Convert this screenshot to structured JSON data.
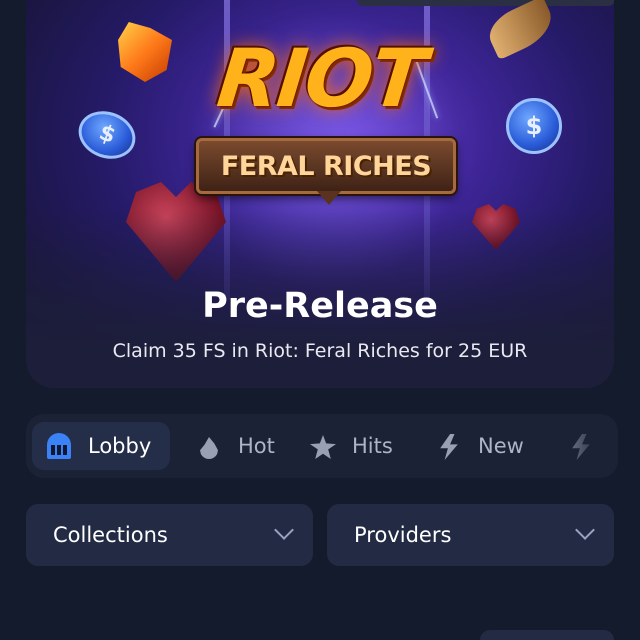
{
  "banner": {
    "logo_title": "RIOT",
    "logo_subtitle": "FERAL RICHES",
    "coin_symbol": "$",
    "title": "Pre-Release",
    "subtitle": "Claim 35 FS in Riot: Feral Riches for 25 EUR"
  },
  "tabs": [
    {
      "label": "Lobby",
      "icon": "slot-machine-icon",
      "active": true
    },
    {
      "label": "Hot",
      "icon": "fire-icon",
      "active": false
    },
    {
      "label": "Hits",
      "icon": "stars-icon",
      "active": false
    },
    {
      "label": "New",
      "icon": "lightning-icon",
      "active": false
    },
    {
      "label": "",
      "icon": "lightning-icon",
      "active": false
    }
  ],
  "filters": {
    "collections_label": "Collections",
    "providers_label": "Providers"
  },
  "colors": {
    "background": "#141b2d",
    "panel": "#1b2236",
    "active_tab": "#252e48",
    "dropdown": "#232a44",
    "accent_blue": "#3b82f6"
  }
}
